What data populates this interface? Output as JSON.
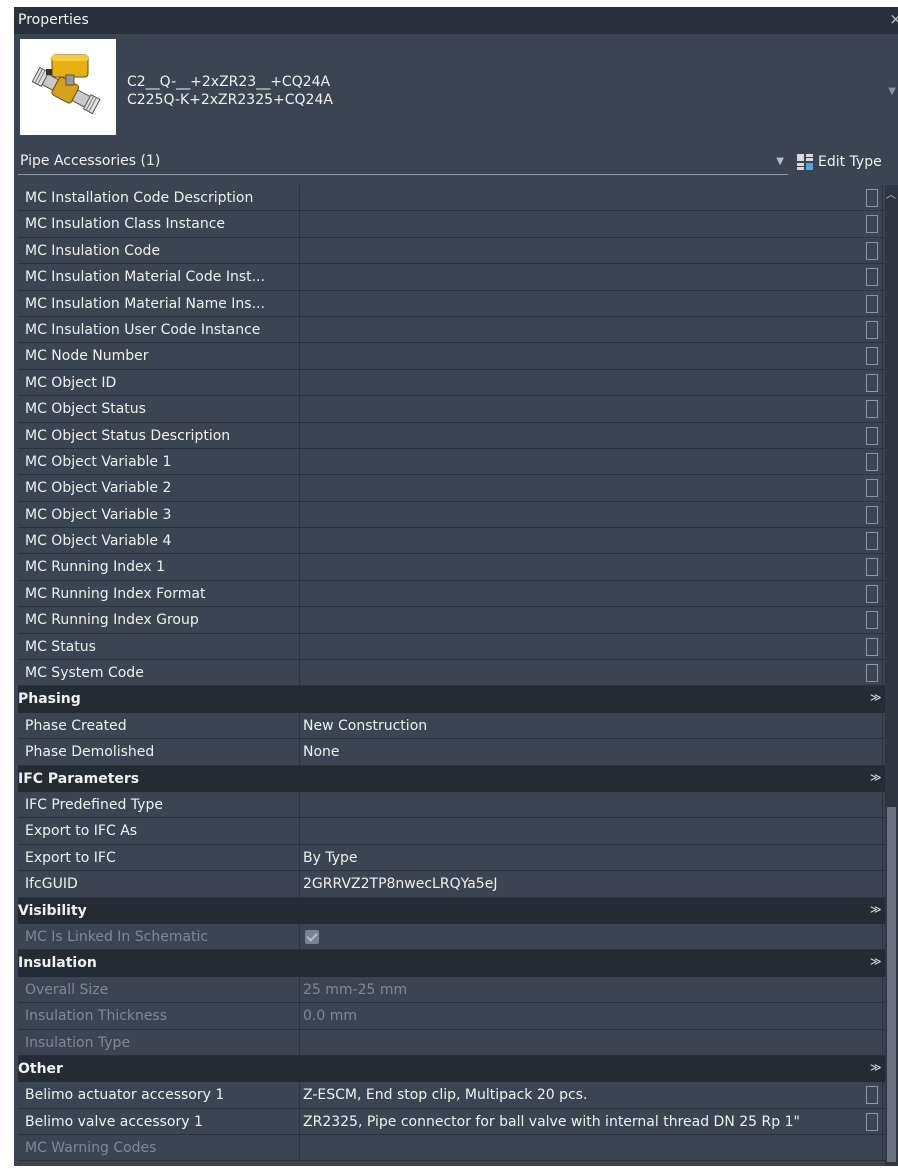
{
  "panel": {
    "title": "Properties",
    "close_glyph": "×"
  },
  "type_selector": {
    "name_line1": "C2__Q-__+2xZR23__+CQ24A",
    "name_line2": "C225Q-K+2xZR2325+CQ24A",
    "thumbnail_icon": "ball-valve-actuator-icon"
  },
  "filter": {
    "label": "Pipe Accessories (1)",
    "edit_type_label": "Edit Type",
    "edit_type_icon": "edit-type-icon"
  },
  "rows": [
    {
      "name": "MC Installation Code Description",
      "value": ""
    },
    {
      "name": "MC Insulation Class Instance",
      "value": ""
    },
    {
      "name": "MC Insulation Code",
      "value": ""
    },
    {
      "name": "MC Insulation Material Code Inst...",
      "value": ""
    },
    {
      "name": "MC Insulation Material Name Ins...",
      "value": ""
    },
    {
      "name": "MC Insulation User Code Instance",
      "value": ""
    },
    {
      "name": "MC Node Number",
      "value": ""
    },
    {
      "name": "MC Object ID",
      "value": ""
    },
    {
      "name": "MC Object Status",
      "value": ""
    },
    {
      "name": "MC Object Status Description",
      "value": ""
    },
    {
      "name": "MC Object Variable 1",
      "value": ""
    },
    {
      "name": "MC Object Variable 2",
      "value": ""
    },
    {
      "name": "MC Object Variable 3",
      "value": ""
    },
    {
      "name": "MC Object Variable 4",
      "value": ""
    },
    {
      "name": "MC Running Index 1",
      "value": ""
    },
    {
      "name": "MC Running Index Format",
      "value": ""
    },
    {
      "name": "MC Running Index Group",
      "value": ""
    },
    {
      "name": "MC Status",
      "value": ""
    },
    {
      "name": "MC System Code",
      "value": ""
    }
  ],
  "groups": {
    "phasing": {
      "title": "Phasing",
      "rows": [
        {
          "name": "Phase Created",
          "value": "New Construction"
        },
        {
          "name": "Phase Demolished",
          "value": "None"
        }
      ]
    },
    "ifc": {
      "title": "IFC Parameters",
      "rows": [
        {
          "name": "IFC Predefined Type",
          "value": ""
        },
        {
          "name": "Export to IFC As",
          "value": ""
        },
        {
          "name": "Export to IFC",
          "value": "By Type"
        },
        {
          "name": "IfcGUID",
          "value": "2GRRVZ2TP8nwecLRQYa5eJ"
        }
      ]
    },
    "visibility": {
      "title": "Visibility",
      "rows": [
        {
          "name": "MC Is Linked In Schematic",
          "checked": true
        }
      ]
    },
    "insulation": {
      "title": "Insulation",
      "rows": [
        {
          "name": "Overall Size",
          "value": "25 mm-25 mm"
        },
        {
          "name": "Insulation Thickness",
          "value": "0.0 mm"
        },
        {
          "name": "Insulation Type",
          "value": ""
        }
      ]
    },
    "other": {
      "title": "Other",
      "rows": [
        {
          "name": "Belimo actuator accessory 1",
          "value": "Z-ESCM, End stop clip, Multipack 20 pcs."
        },
        {
          "name": "Belimo valve accessory 1",
          "value": "ZR2325, Pipe connector for ball valve with internal thread DN 25 Rp 1\""
        },
        {
          "name": "MC Warning Codes",
          "value": ""
        }
      ]
    }
  },
  "collapse_glyph": "≫"
}
